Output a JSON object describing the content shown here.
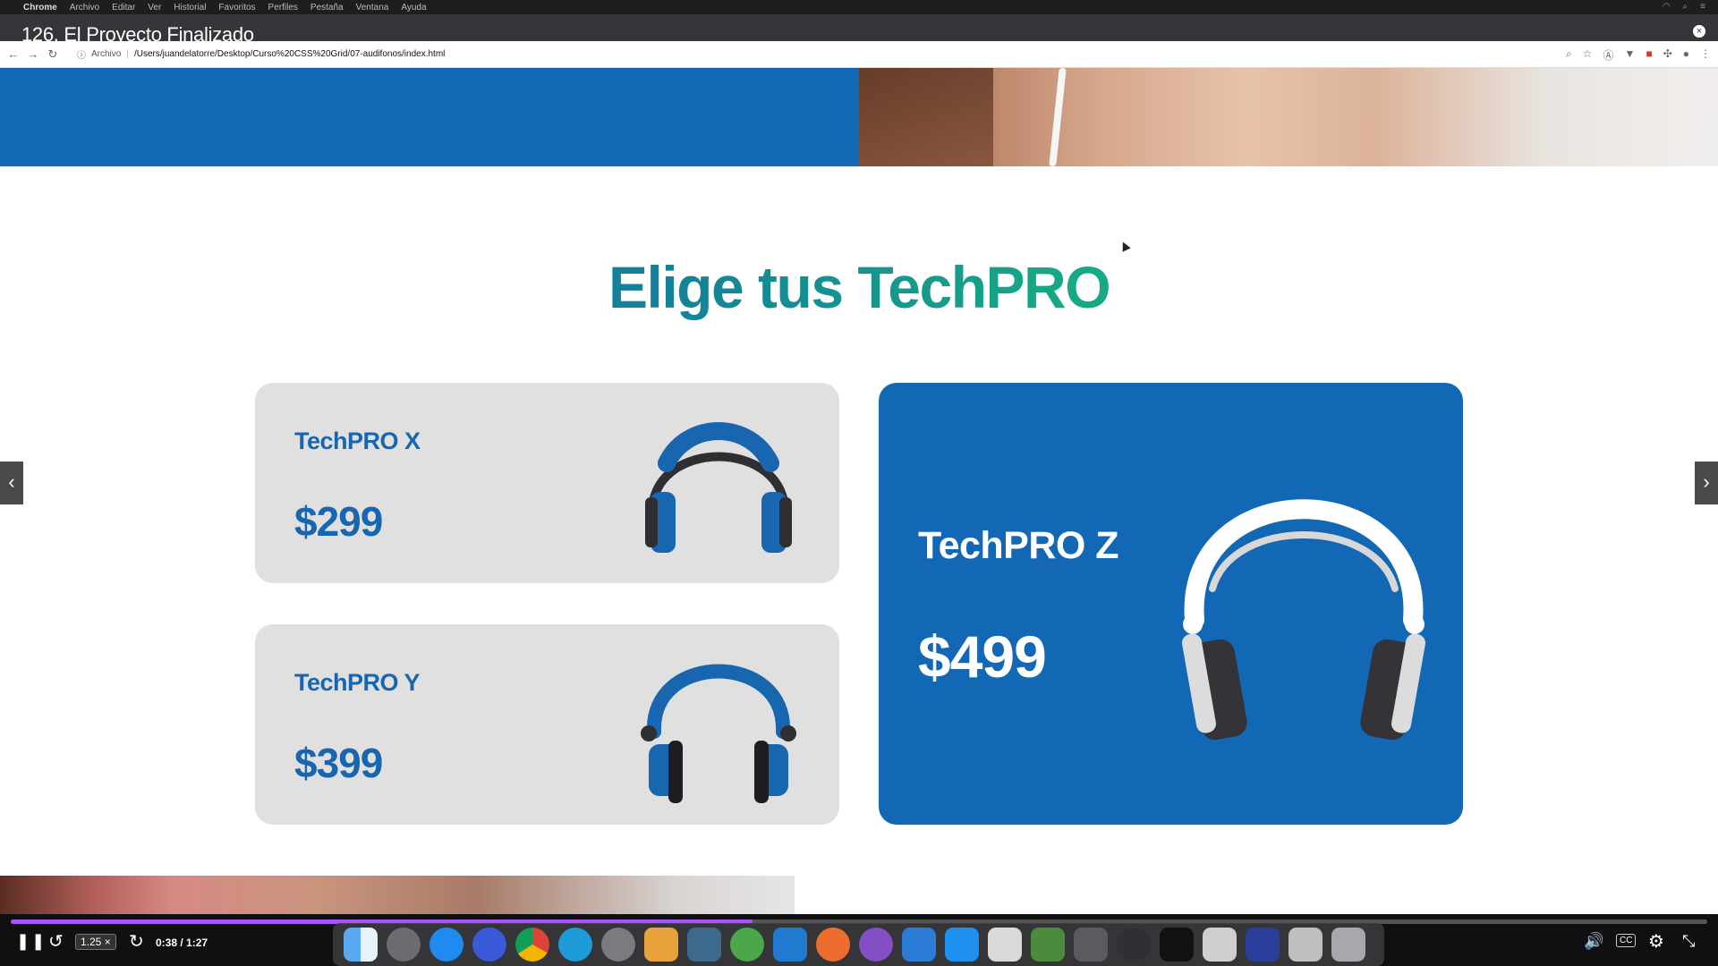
{
  "menubar": {
    "items": [
      "Chrome",
      "Archivo",
      "Editar",
      "Ver",
      "Historial",
      "Favoritos",
      "Perfiles",
      "Pestaña",
      "Ventana",
      "Ayuda"
    ]
  },
  "video": {
    "title": "126. El Proyecto Finalizado"
  },
  "browser": {
    "archivo_label": "Archivo",
    "url": "/Users/juandelatorre/Desktop/Curso%20CSS%20Grid/07-audifonos/index.html"
  },
  "page": {
    "section_title": "Elige tus TechPRO",
    "products": [
      {
        "name": "TechPRO X",
        "price": "$299"
      },
      {
        "name": "TechPRO Y",
        "price": "$399"
      },
      {
        "name": "TechPRO Z",
        "price": "$499"
      }
    ]
  },
  "player": {
    "speed": "1.25 ×",
    "time": "0:38 / 1:27",
    "progress_fraction": 0.437,
    "cc_label": "CC"
  },
  "colors": {
    "brand_blue": "#1268b4",
    "card_gray": "#e0e0e0",
    "title_teal": "#14809a",
    "title_green": "#17a884",
    "progress": "#a855f7"
  },
  "icons": [
    "apple-icon",
    "back-arrow-icon",
    "forward-arrow-icon",
    "reload-icon",
    "info-icon",
    "zoom-icon",
    "star-icon",
    "extensions-icon",
    "profile-icon",
    "menu-dots-icon",
    "headphones-icon",
    "chevron-left-icon",
    "chevron-right-icon",
    "pause-icon",
    "replay-icon",
    "forward-icon",
    "volume-icon",
    "cc-icon",
    "gear-icon",
    "fullscreen-exit-icon"
  ]
}
